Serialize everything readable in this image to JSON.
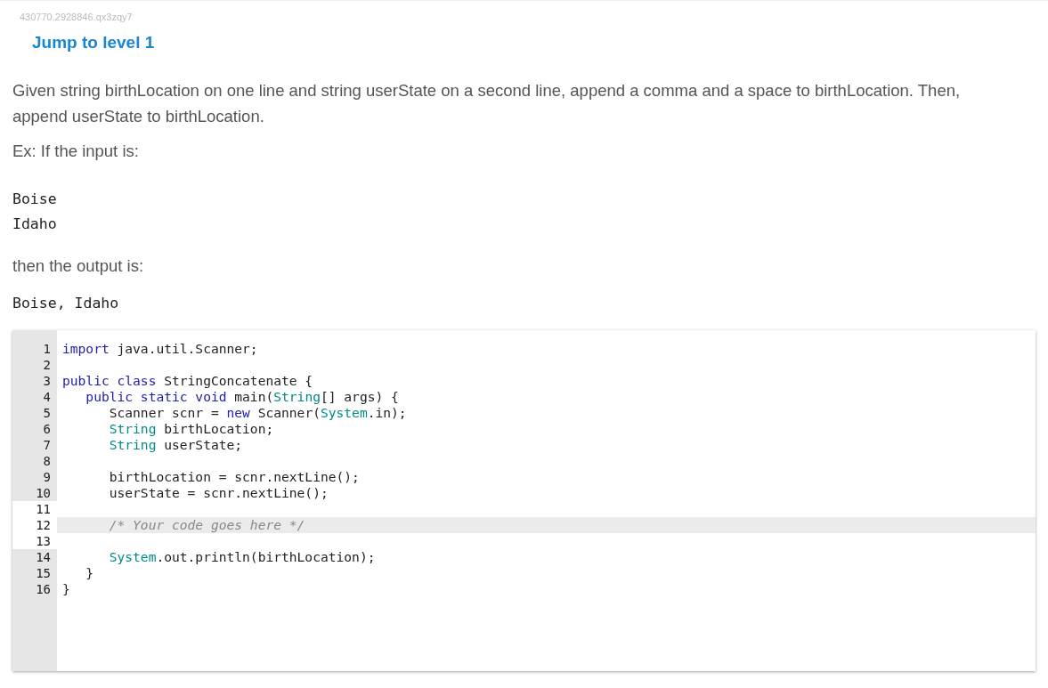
{
  "header": {
    "id_text": "430770.2928846.qx3zqy7",
    "jump_link": "Jump to level 1"
  },
  "prompt": {
    "paragraphs": [
      "Given string birthLocation on one line and string userState on a second line, append a comma and a space to birthLocation. Then, append userState to birthLocation.",
      "Ex: If the input is:"
    ],
    "example_input": [
      "Boise",
      "Idaho"
    ],
    "output_intro": "then the output is:",
    "example_output": [
      "Boise, Idaho"
    ]
  },
  "editor": {
    "lines": [
      {
        "number": "1",
        "editable": false,
        "active": false,
        "tokens": [
          {
            "kind": "keyword",
            "text": "import"
          },
          {
            "kind": "plain",
            "text": " java.util.Scanner;"
          }
        ]
      },
      {
        "number": "2",
        "editable": false,
        "active": false
      },
      {
        "number": "3",
        "editable": false,
        "active": false,
        "tokens": [
          {
            "kind": "keyword",
            "text": "public class"
          },
          {
            "kind": "plain",
            "text": " StringConcatenate {"
          }
        ]
      },
      {
        "number": "4",
        "editable": false,
        "active": false,
        "tokens": [
          {
            "kind": "keyword",
            "text": "   public static void"
          },
          {
            "kind": "plain",
            "text": " main("
          },
          {
            "kind": "type",
            "text": "String"
          },
          {
            "kind": "plain",
            "text": "[] args) {"
          }
        ]
      },
      {
        "number": "5",
        "editable": false,
        "active": false,
        "tokens": [
          {
            "kind": "plain",
            "text": "      Scanner scnr = "
          },
          {
            "kind": "keyword",
            "text": "new"
          },
          {
            "kind": "plain",
            "text": " Scanner("
          },
          {
            "kind": "type",
            "text": "System"
          },
          {
            "kind": "plain",
            "text": ".in);"
          }
        ]
      },
      {
        "number": "6",
        "editable": false,
        "active": false,
        "tokens": [
          {
            "kind": "type",
            "text": "      String"
          },
          {
            "kind": "plain",
            "text": " birthLocation;"
          }
        ]
      },
      {
        "number": "7",
        "editable": false,
        "active": false,
        "tokens": [
          {
            "kind": "type",
            "text": "      String"
          },
          {
            "kind": "plain",
            "text": " userState;"
          }
        ]
      },
      {
        "number": "8",
        "editable": false,
        "active": false
      },
      {
        "number": "9",
        "editable": false,
        "active": false,
        "tokens": [
          {
            "kind": "plain",
            "text": "      birthLocation = scnr.nextLine();"
          }
        ]
      },
      {
        "number": "10",
        "editable": false,
        "active": false,
        "tokens": [
          {
            "kind": "plain",
            "text": "      userState = scnr.nextLine();"
          }
        ]
      },
      {
        "number": "11",
        "editable": true,
        "active": false
      },
      {
        "number": "12",
        "editable": true,
        "active": true,
        "tokens": [
          {
            "kind": "comment",
            "text": "      /* Your code goes here */"
          }
        ]
      },
      {
        "number": "13",
        "editable": true,
        "active": false
      },
      {
        "number": "14",
        "editable": false,
        "active": false,
        "tokens": [
          {
            "kind": "type",
            "text": "      System"
          },
          {
            "kind": "plain",
            "text": ".out.println(birthLocation);"
          }
        ]
      },
      {
        "number": "15",
        "editable": false,
        "active": false,
        "tokens": [
          {
            "kind": "plain",
            "text": "   }"
          }
        ]
      },
      {
        "number": "16",
        "editable": false,
        "active": false,
        "tokens": [
          {
            "kind": "plain",
            "text": "}"
          }
        ]
      }
    ]
  }
}
